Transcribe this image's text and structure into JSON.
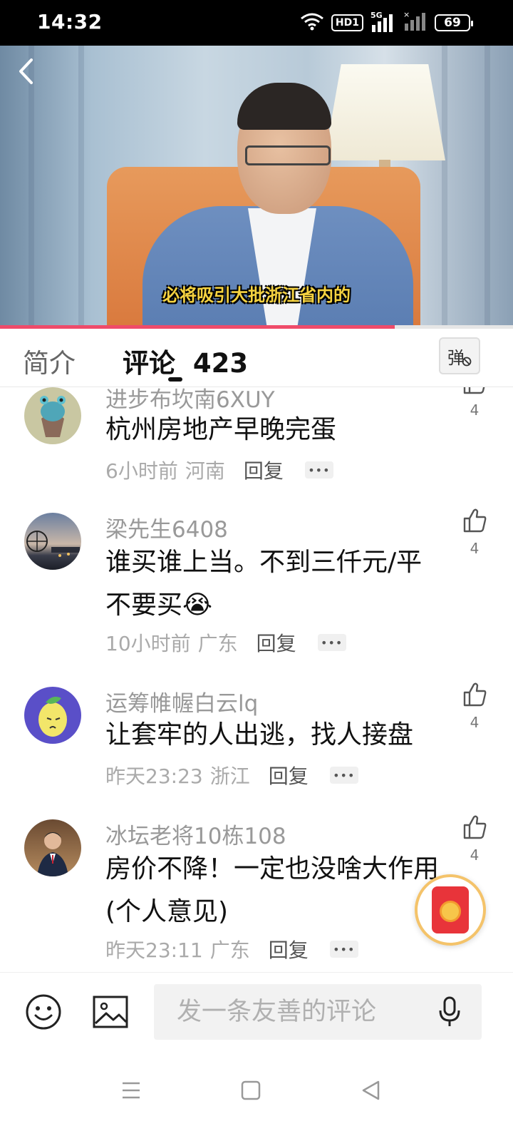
{
  "status_bar": {
    "time": "14:32",
    "network": "5G",
    "hd_badge": "HD1",
    "battery": "69",
    "icons": [
      "wifi-icon",
      "hd-icon",
      "signal-5g-icon",
      "signal-no-service-icon",
      "battery-icon"
    ]
  },
  "video": {
    "subtitle": "必将吸引大批浙江省内的",
    "progress": 0.77,
    "progress_color": "#ef4b6a",
    "back_icon": "chevron-left-icon"
  },
  "tabs": {
    "intro": "简介",
    "comments": "评论",
    "comment_count": "423",
    "danmu": "弹"
  },
  "comments": [
    {
      "name": "进步布坎南6XUY",
      "text": "杭州房地产早晚完蛋",
      "time": "6小时前",
      "location": "河南",
      "reply": "回复",
      "likes": "4"
    },
    {
      "name": "梁先生6408",
      "text": "谁买谁上当。不到三仟元/平不要买😭",
      "time": "10小时前",
      "location": "广东",
      "reply": "回复",
      "likes": "4"
    },
    {
      "name": "运筹帷幄白云lq",
      "text": "让套牢的人出逃，找人接盘",
      "time": "昨天23:23",
      "location": "浙江",
      "reply": "回复",
      "likes": "4"
    },
    {
      "name": "冰坛老将10栋108",
      "text": "房价不降！一定也没啥大作用(个人意见)",
      "time": "昨天23:11",
      "location": "广东",
      "reply": "回复",
      "likes": "4"
    }
  ],
  "input": {
    "placeholder": "发一条友善的评论",
    "emoji_icon": "smiley-icon",
    "image_icon": "image-icon",
    "mic_icon": "microphone-icon"
  },
  "floating": {
    "icon": "red-envelope-icon"
  },
  "nav": {
    "icons": [
      "menu-icon",
      "home-square-icon",
      "back-triangle-icon"
    ]
  }
}
